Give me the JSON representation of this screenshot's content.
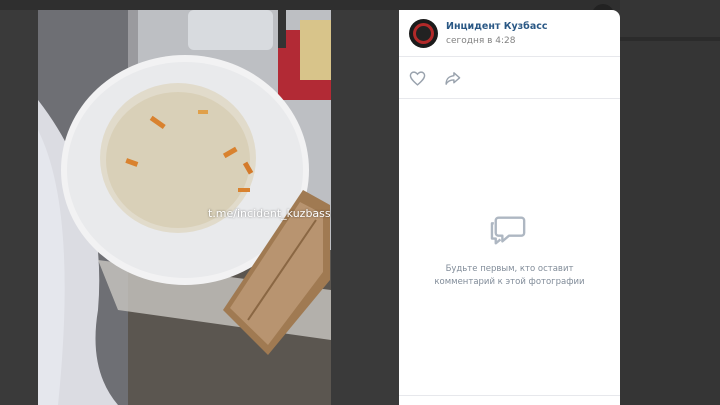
{
  "photo": {
    "watermark": "t.me/incident_kuzbass"
  },
  "post": {
    "author": "Инцидент Кузбасс",
    "time": "сегодня в 4:28"
  },
  "actions": {
    "like_icon": "heart-icon",
    "share_icon": "share-arrow-icon"
  },
  "comments": {
    "empty_icon": "comments-icon",
    "empty_line1": "Будьте первым, кто оставит",
    "empty_line2": "комментарий к этой фотографии"
  }
}
